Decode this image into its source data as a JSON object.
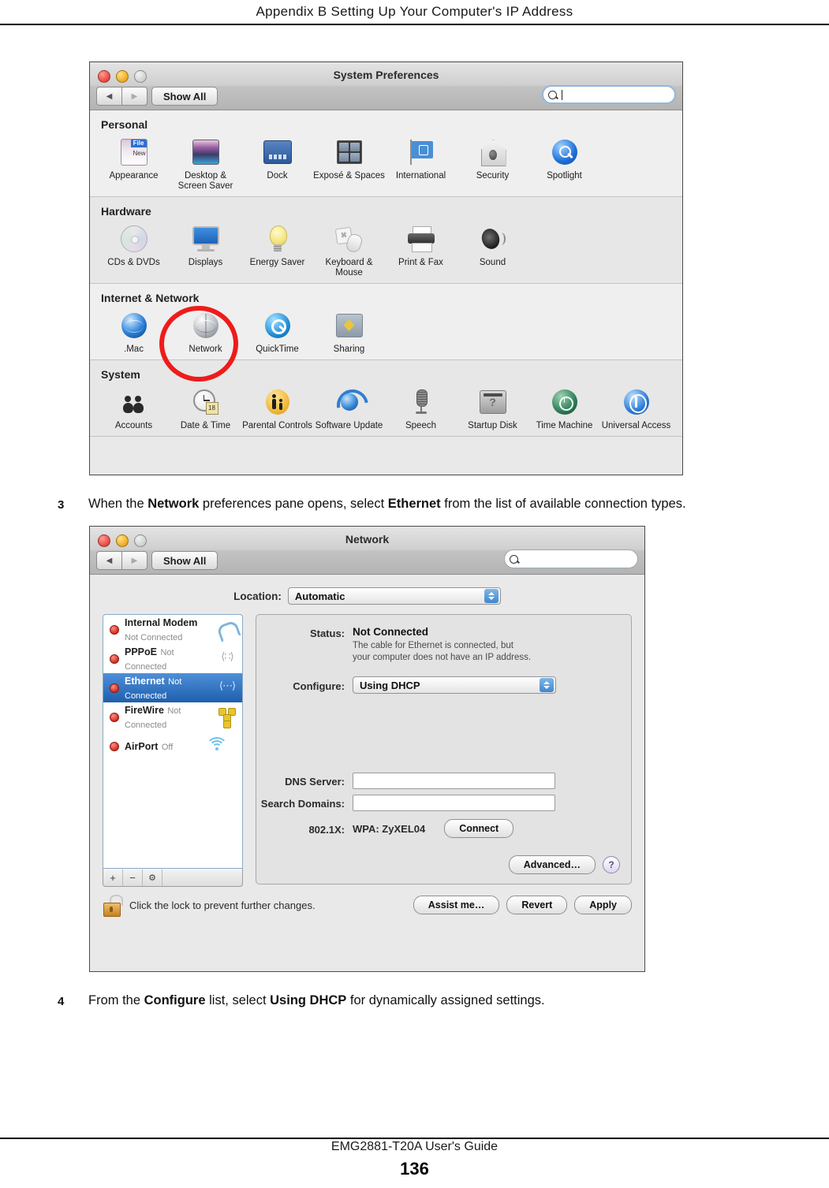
{
  "page": {
    "header": "Appendix B Setting Up Your Computer's IP Address",
    "footer_guide": "EMG2881-T20A User's Guide",
    "footer_page": "136"
  },
  "steps": [
    {
      "number": "3",
      "parts": [
        {
          "text": "When the ",
          "bold": false
        },
        {
          "text": "Network",
          "bold": true
        },
        {
          "text": " preferences pane opens, select ",
          "bold": false
        },
        {
          "text": "Ethernet",
          "bold": true
        },
        {
          "text": " from the list of available connection types.",
          "bold": false
        }
      ]
    },
    {
      "number": "4",
      "parts": [
        {
          "text": "From the ",
          "bold": false
        },
        {
          "text": "Configure",
          "bold": true
        },
        {
          "text": " list, select ",
          "bold": false
        },
        {
          "text": "Using DHCP",
          "bold": true
        },
        {
          "text": " for dynamically assigned settings.",
          "bold": false
        }
      ]
    }
  ],
  "sysprefs": {
    "title": "System Preferences",
    "toolbar": {
      "back_icon": "back-arrow-icon",
      "forward_icon": "forward-arrow-icon",
      "show_all_label": "Show All",
      "search_placeholder": "",
      "search_value": "",
      "search_icon": "search-icon"
    },
    "groups": [
      {
        "title": "Personal",
        "items": [
          {
            "label": "Appearance",
            "icon": "appearance-icon"
          },
          {
            "label": "Desktop &\nScreen Saver",
            "icon": "desktop-screensaver-icon"
          },
          {
            "label": "Dock",
            "icon": "dock-icon"
          },
          {
            "label": "Exposé &\nSpaces",
            "icon": "expose-spaces-icon"
          },
          {
            "label": "International",
            "icon": "international-icon"
          },
          {
            "label": "Security",
            "icon": "security-icon"
          },
          {
            "label": "Spotlight",
            "icon": "spotlight-icon"
          }
        ]
      },
      {
        "title": "Hardware",
        "items": [
          {
            "label": "CDs & DVDs",
            "icon": "cds-dvds-icon"
          },
          {
            "label": "Displays",
            "icon": "displays-icon"
          },
          {
            "label": "Energy\nSaver",
            "icon": "energy-saver-icon"
          },
          {
            "label": "Keyboard &\nMouse",
            "icon": "keyboard-mouse-icon"
          },
          {
            "label": "Print & Fax",
            "icon": "print-fax-icon"
          },
          {
            "label": "Sound",
            "icon": "sound-icon"
          }
        ]
      },
      {
        "title": "Internet & Network",
        "items": [
          {
            "label": ".Mac",
            "icon": "dot-mac-icon"
          },
          {
            "label": "Network",
            "icon": "network-icon",
            "highlighted": true
          },
          {
            "label": "QuickTime",
            "icon": "quicktime-icon"
          },
          {
            "label": "Sharing",
            "icon": "sharing-icon"
          }
        ]
      },
      {
        "title": "System",
        "items": [
          {
            "label": "Accounts",
            "icon": "accounts-icon"
          },
          {
            "label": "Date & Time",
            "icon": "date-time-icon"
          },
          {
            "label": "Parental\nControls",
            "icon": "parental-controls-icon"
          },
          {
            "label": "Software\nUpdate",
            "icon": "software-update-icon"
          },
          {
            "label": "Speech",
            "icon": "speech-icon"
          },
          {
            "label": "Startup Disk",
            "icon": "startup-disk-icon"
          },
          {
            "label": "Time Machine",
            "icon": "time-machine-icon"
          },
          {
            "label": "Universal\nAccess",
            "icon": "universal-access-icon"
          }
        ]
      }
    ],
    "highlight_color": "#EF1B1B"
  },
  "network": {
    "title": "Network",
    "toolbar": {
      "show_all_label": "Show All",
      "search_value": "",
      "search_icon": "search-icon"
    },
    "location": {
      "label": "Location:",
      "value": "Automatic"
    },
    "services": [
      {
        "name": "Internal Modem",
        "state": "Not Connected",
        "icon": "modem-icon",
        "selected": false
      },
      {
        "name": "PPPoE",
        "state": "Not Connected",
        "icon": "pppoe-icon",
        "selected": false
      },
      {
        "name": "Ethernet",
        "state": "Not Connected",
        "icon": "ethernet-icon",
        "selected": true
      },
      {
        "name": "FireWire",
        "state": "Not Connected",
        "icon": "firewire-icon",
        "selected": false
      },
      {
        "name": "AirPort",
        "state": "Off",
        "icon": "airport-icon",
        "selected": false
      }
    ],
    "service_toolbar": {
      "add": "+",
      "remove": "−",
      "actions": "⚙"
    },
    "detail": {
      "status_label": "Status:",
      "status_value": "Not Connected",
      "status_note": "The cable for Ethernet is connected, but\nyour computer does not have an IP address.",
      "configure_label": "Configure:",
      "configure_value": "Using DHCP",
      "dns_label": "DNS Server:",
      "dns_value": "",
      "search_domains_label": "Search Domains:",
      "search_domains_value": "",
      "dot1x_label": "802.1X:",
      "dot1x_value": "WPA: ZyXEL04",
      "connect_label": "Connect",
      "advanced_label": "Advanced…",
      "help_label": "?"
    },
    "footer": {
      "lock_icon": "unlocked-padlock-icon",
      "lock_text": "Click the lock to prevent further changes.",
      "assist_label": "Assist me…",
      "revert_label": "Revert",
      "apply_label": "Apply"
    }
  }
}
